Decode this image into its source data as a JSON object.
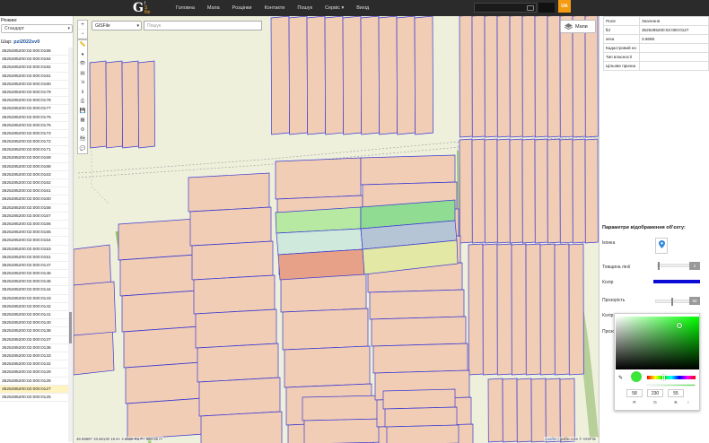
{
  "topbar": {
    "logo_g": "G",
    "logo_i": "I",
    "logo_s": "S",
    "logo_small": "file",
    "nav": [
      "Головна",
      "Мапа",
      "Розцінки",
      "Контакти",
      "Пошук",
      "Сервіс ▾",
      "Вихід"
    ],
    "lang": "UA"
  },
  "left": {
    "mode_label": "Режим:",
    "mode_value": "Стандарт",
    "layer_label": "Шар:",
    "layer_value": "pzi2022sv0",
    "cadastral": [
      "3525285200:02:000:0186",
      "3525285200:02:000:0184",
      "3525285200:02:000:0182",
      "3525285200:02:000:0181",
      "3525285200:02:000:0180",
      "3525285200:02:000:0179",
      "3525285200:02:000:0178",
      "3525285200:02:000:0177",
      "3525285200:02:000:0176",
      "3525285200:02:000:0175",
      "3525285200:02:000:0173",
      "3525285200:02:000:0172",
      "3525285200:02:000:0171",
      "3525285200:02:000:0169",
      "3525285200:02:000:0168",
      "3525285200:02:000:0163",
      "3525285200:02:000:0162",
      "3525285200:02:000:0161",
      "3525285200:02:000:0160",
      "3525285200:02:000:0158",
      "3525285200:02:000:0157",
      "3525285200:02:000:0156",
      "3525285200:02:000:0155",
      "3525285200:02:000:0154",
      "3525285200:02:000:0153",
      "3525285200:02:000:0151",
      "3525285200:02:000:0147",
      "3525285200:02:000:0146",
      "3525285200:02:000:0145",
      "3525285200:02:000:0144",
      "3525285200:02:000:0143",
      "3525285200:02:000:0142",
      "3525285200:02:000:0141",
      "3525285200:02:000:0140",
      "3525285200:02:000:0138",
      "3525285200:02:000:0137",
      "3525285200:02:000:0136",
      "3525285200:02:000:0133",
      "3525285200:02:000:0132",
      "3525285200:02:000:0129",
      "3525285200:02:000:0128",
      "3525285200:02:000:0127",
      "3525285200:02:000:0125"
    ]
  },
  "map": {
    "basemap": "GISFile",
    "search_placeholder": "Пошук",
    "maps_label": "Мапи",
    "coords": "48.59697 33.66130 16.5× 3.8660 Ra P= 583.65 m",
    "attrib_leaflet": "Leaflet",
    "attrib_rest": "| gisfile.com © GISFile"
  },
  "right": {
    "table_headers": [
      "Поле",
      "Значення"
    ],
    "rows": [
      {
        "k": "fid",
        "v": "3525285200:02:000:0127"
      },
      {
        "k": "area",
        "v": "3.6688"
      },
      {
        "k": "Кадастровий но",
        "v": ""
      },
      {
        "k": "Тип власності",
        "v": ""
      },
      {
        "k": "Цільове призна",
        "v": ""
      }
    ],
    "params_title": "Параметри відображення об'єкту:",
    "icon_label": "Іконка",
    "linewidth_label": "Товщина лінії",
    "linewidth_value": "1",
    "color_label": "Колір",
    "opacity_label": "Прозорість",
    "opacity_value": "50",
    "fill_label": "Колір заливки",
    "fill_opacity_label": "Прозо",
    "line_color": "#0b0bd6",
    "fill_color": "#3ae637"
  },
  "colorpicker": {
    "r": "58",
    "g": "230",
    "b": "55",
    "labels": [
      "R",
      "G",
      "B"
    ],
    "extra_label": "↕"
  }
}
